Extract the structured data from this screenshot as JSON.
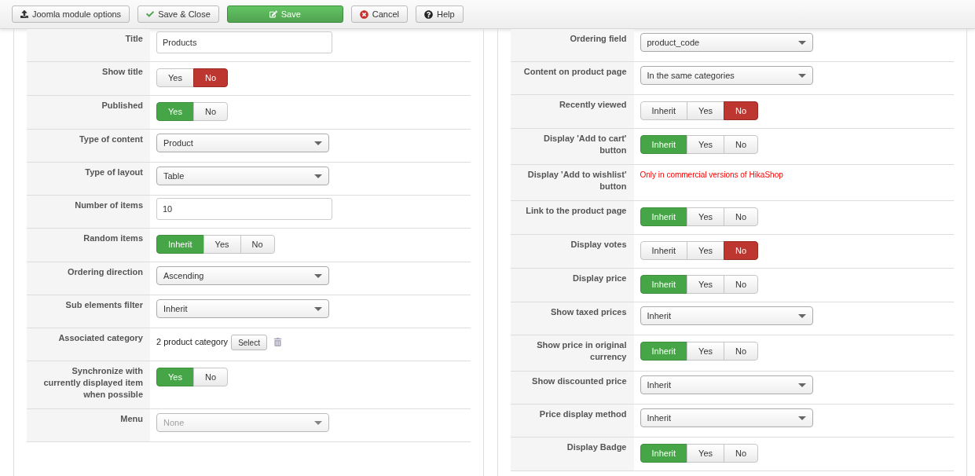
{
  "toolbar": [
    {
      "kind": "upload",
      "label": "Joomla module options"
    },
    {
      "kind": "check",
      "label": "Save & Close"
    },
    {
      "kind": "save",
      "label": "Save"
    },
    {
      "kind": "cancel",
      "label": "Cancel"
    },
    {
      "kind": "help",
      "label": "Help"
    }
  ],
  "left_panel": [
    {
      "kind": "text",
      "label": "Title",
      "value": "Products"
    },
    {
      "kind": "toggle",
      "label": "Show title",
      "options": [
        {
          "label": "Yes",
          "kind": "positive",
          "selected": false
        },
        {
          "label": "No",
          "kind": "negative",
          "selected": true
        }
      ]
    },
    {
      "kind": "toggle",
      "label": "Published",
      "options": [
        {
          "label": "Yes",
          "kind": "positive",
          "selected": true
        },
        {
          "label": "No",
          "kind": "negative",
          "selected": false
        }
      ]
    },
    {
      "kind": "select",
      "label": "Type of content",
      "value": "Product"
    },
    {
      "kind": "select",
      "label": "Type of layout",
      "value": "Table"
    },
    {
      "kind": "text",
      "label": "Number of items",
      "value": "10"
    },
    {
      "kind": "toggle",
      "label": "Random items",
      "options": [
        {
          "label": "Inherit",
          "kind": "positive",
          "selected": true
        },
        {
          "label": "Yes",
          "kind": "positive",
          "selected": false
        },
        {
          "label": "No",
          "kind": "negative",
          "selected": false
        }
      ]
    },
    {
      "kind": "select",
      "label": "Ordering direction",
      "value": "Ascending"
    },
    {
      "kind": "select",
      "label": "Sub elements filter",
      "value": "Inherit"
    },
    {
      "kind": "category",
      "label": "Associated category",
      "value": "2 product category",
      "button": "Select"
    },
    {
      "kind": "toggle",
      "label": "Synchronize with currently displayed item when possible",
      "options": [
        {
          "label": "Yes",
          "kind": "positive",
          "selected": true
        },
        {
          "label": "No",
          "kind": "negative",
          "selected": false
        }
      ]
    },
    {
      "kind": "select",
      "label": "Menu",
      "value": "None",
      "disabled": true
    }
  ],
  "right_panel": [
    {
      "kind": "select",
      "label": "Ordering field",
      "value": "product_code"
    },
    {
      "kind": "select",
      "label": "Content on product page",
      "value": "In the same categories"
    },
    {
      "kind": "toggle",
      "label": "Recently viewed",
      "options": [
        {
          "label": "Inherit",
          "kind": "positive",
          "selected": false
        },
        {
          "label": "Yes",
          "kind": "positive",
          "selected": false
        },
        {
          "label": "No",
          "kind": "negative",
          "selected": true
        }
      ]
    },
    {
      "kind": "toggle",
      "label": "Display 'Add to cart' button",
      "options": [
        {
          "label": "Inherit",
          "kind": "positive",
          "selected": true
        },
        {
          "label": "Yes",
          "kind": "positive",
          "selected": false
        },
        {
          "label": "No",
          "kind": "negative",
          "selected": false
        }
      ]
    },
    {
      "kind": "note",
      "label": "Display 'Add to wishlist' button",
      "value": "Only in commercial versions of HikaShop"
    },
    {
      "kind": "toggle",
      "label": "Link to the product page",
      "options": [
        {
          "label": "Inherit",
          "kind": "positive",
          "selected": true
        },
        {
          "label": "Yes",
          "kind": "positive",
          "selected": false
        },
        {
          "label": "No",
          "kind": "negative",
          "selected": false
        }
      ]
    },
    {
      "kind": "toggle",
      "label": "Display votes",
      "options": [
        {
          "label": "Inherit",
          "kind": "positive",
          "selected": false
        },
        {
          "label": "Yes",
          "kind": "positive",
          "selected": false
        },
        {
          "label": "No",
          "kind": "negative",
          "selected": true
        }
      ]
    },
    {
      "kind": "toggle",
      "label": "Display price",
      "options": [
        {
          "label": "Inherit",
          "kind": "positive",
          "selected": true
        },
        {
          "label": "Yes",
          "kind": "positive",
          "selected": false
        },
        {
          "label": "No",
          "kind": "negative",
          "selected": false
        }
      ]
    },
    {
      "kind": "select",
      "label": "Show taxed prices",
      "value": "Inherit"
    },
    {
      "kind": "toggle",
      "label": "Show price in original currency",
      "options": [
        {
          "label": "Inherit",
          "kind": "positive",
          "selected": true
        },
        {
          "label": "Yes",
          "kind": "positive",
          "selected": false
        },
        {
          "label": "No",
          "kind": "negative",
          "selected": false
        }
      ]
    },
    {
      "kind": "select",
      "label": "Show discounted price",
      "value": "Inherit"
    },
    {
      "kind": "select",
      "label": "Price display method",
      "value": "Inherit"
    },
    {
      "kind": "toggle",
      "label": "Display Badge",
      "options": [
        {
          "label": "Inherit",
          "kind": "positive",
          "selected": true
        },
        {
          "label": "Yes",
          "kind": "positive",
          "selected": false
        },
        {
          "label": "No",
          "kind": "negative",
          "selected": false
        }
      ]
    }
  ]
}
